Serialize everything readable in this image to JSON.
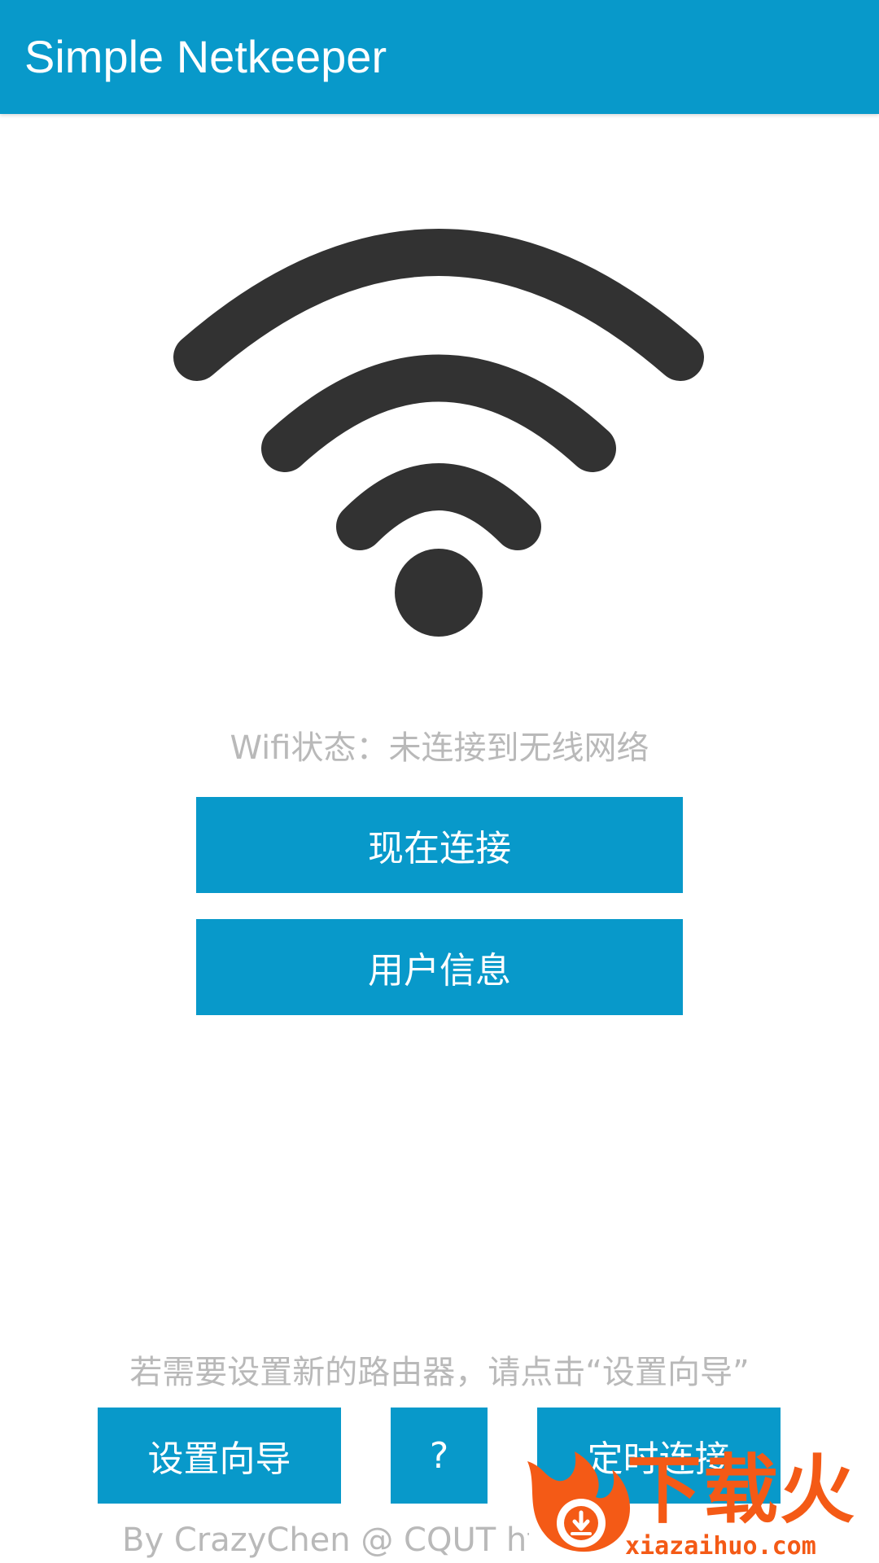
{
  "app": {
    "title": "Simple Netkeeper"
  },
  "icons": {
    "wifi": "wifi-icon",
    "watermark_logo": "flame-download-logo"
  },
  "main": {
    "wifi_status": "Wifi状态：未连接到无线网络",
    "connect_label": "现在连接",
    "userinfo_label": "用户信息"
  },
  "bottom": {
    "hint": "若需要设置新的路由器，请点击“设置向导”",
    "wizard_label": "设置向导",
    "help_label": "?",
    "timer_label": "定时连接",
    "footer": "By CrazyChen @ CQUT htt"
  },
  "watermark": {
    "text": "下载火",
    "url": "xiazaihuo.com"
  },
  "colors": {
    "primary": "#0899ca",
    "icon": "#323232",
    "muted_text": "#b9b9b9",
    "watermark": "#f45a16"
  }
}
